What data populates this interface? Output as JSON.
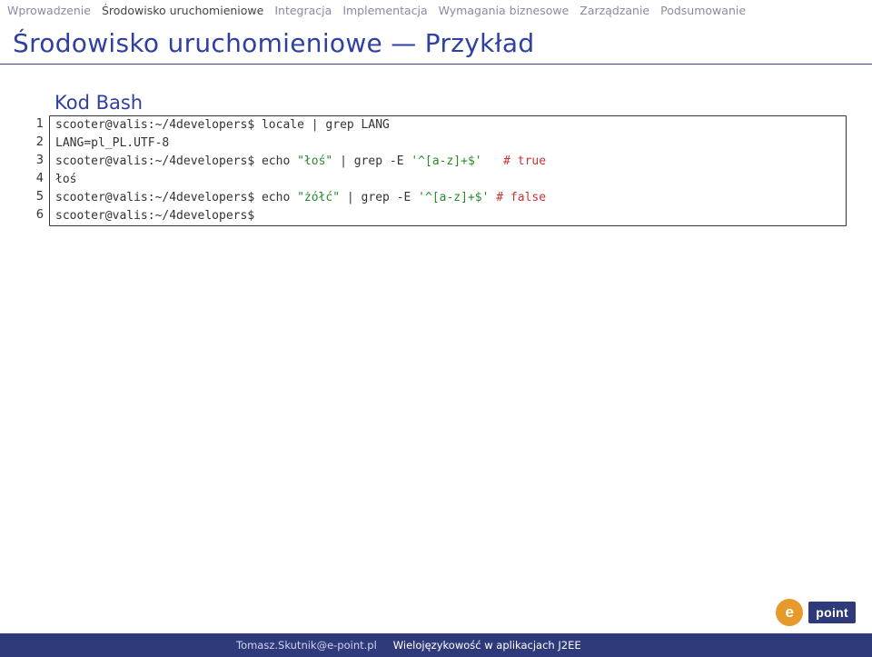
{
  "nav": {
    "items": [
      "Wprowadzenie",
      "Środowisko uruchomieniowe",
      "Integracja",
      "Implementacja",
      "Wymagania biznesowe",
      "Zarządzanie",
      "Podsumowanie"
    ],
    "active_index": 1
  },
  "title": "Środowisko uruchomieniowe — Przykład",
  "code": {
    "heading": "Kod Bash",
    "lines": [
      {
        "n": "1",
        "segs": [
          {
            "t": "scooter@valis:~/4developers$ locale | grep LANG",
            "c": ""
          }
        ]
      },
      {
        "n": "2",
        "segs": [
          {
            "t": "LANG=pl_PL.UTF-8",
            "c": ""
          }
        ]
      },
      {
        "n": "3",
        "segs": [
          {
            "t": "scooter@valis:~/4developers$ echo ",
            "c": ""
          },
          {
            "t": "\"łoś\"",
            "c": "tok-str"
          },
          {
            "t": " | grep -E ",
            "c": ""
          },
          {
            "t": "'^[a-z]+$'",
            "c": "tok-str"
          },
          {
            "t": "   ",
            "c": ""
          },
          {
            "t": "# true",
            "c": "tok-kw"
          }
        ]
      },
      {
        "n": "4",
        "segs": [
          {
            "t": "łoś",
            "c": ""
          }
        ]
      },
      {
        "n": "5",
        "segs": [
          {
            "t": "scooter@valis:~/4developers$ echo ",
            "c": ""
          },
          {
            "t": "\"żółć\"",
            "c": "tok-str"
          },
          {
            "t": " | grep -E ",
            "c": ""
          },
          {
            "t": "'^[a-z]+$'",
            "c": "tok-str"
          },
          {
            "t": " ",
            "c": ""
          },
          {
            "t": "# false",
            "c": "tok-kw"
          }
        ]
      },
      {
        "n": "6",
        "segs": [
          {
            "t": "scooter@valis:~/4developers$",
            "c": ""
          }
        ]
      }
    ]
  },
  "footer": {
    "author": "Tomasz.Skutnik@e-point.pl",
    "talk": "Wielojęzykowość w aplikacjach J2EE"
  },
  "logo": {
    "e": "e",
    "point": "point"
  }
}
